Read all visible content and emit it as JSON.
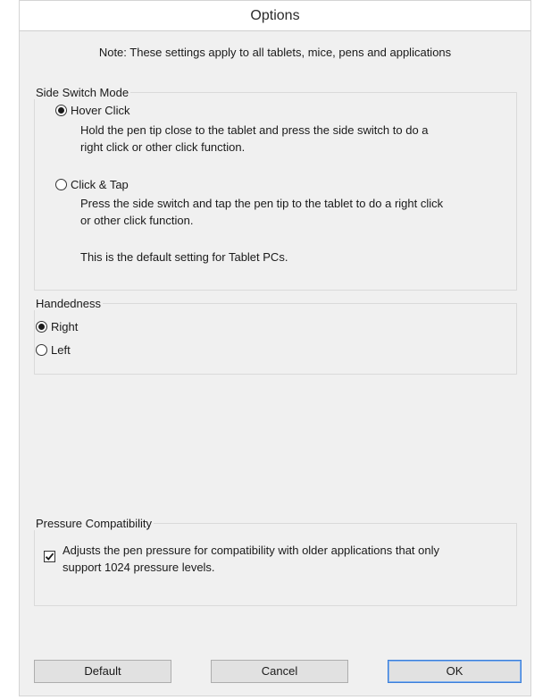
{
  "window": {
    "title": "Options"
  },
  "note": "Note: These settings apply to all tablets, mice, pens and applications",
  "side_switch_mode": {
    "legend": "Side Switch Mode",
    "options": [
      {
        "label": "Hover Click",
        "selected": true,
        "description": [
          "Hold the pen tip close to the tablet and press the side switch to do a",
          "right click or other click function."
        ]
      },
      {
        "label": "Click & Tap",
        "selected": false,
        "description": [
          "Press the side switch and tap the pen tip to the tablet to do a right click",
          "or other click function."
        ]
      }
    ],
    "default_note": "This is the default setting for Tablet PCs."
  },
  "handedness": {
    "legend": "Handedness",
    "options": [
      {
        "label": "Right",
        "selected": true
      },
      {
        "label": "Left",
        "selected": false
      }
    ]
  },
  "pressure_compatibility": {
    "legend": "Pressure Compatibility",
    "checked": true,
    "label": [
      "Adjusts the pen pressure for compatibility with older applications that only",
      "support 1024 pressure levels."
    ]
  },
  "buttons": {
    "default": "Default",
    "cancel": "Cancel",
    "ok": "OK"
  }
}
